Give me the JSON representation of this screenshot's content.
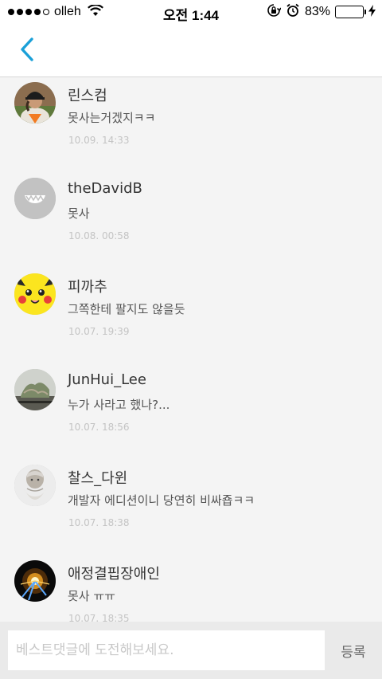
{
  "status_bar": {
    "carrier": "olleh",
    "time": "오전 1:44",
    "battery_percent": "83%",
    "battery_level": 0.83,
    "signal_bars": 4,
    "icons": [
      "signal-dots-icon",
      "wifi-icon",
      "orientation-lock-icon",
      "alarm-icon",
      "battery-icon",
      "charging-bolt-icon"
    ]
  },
  "nav": {
    "back_icon": "chevron-left-icon",
    "accent_color": "#1aa0d8"
  },
  "comments": [
    {
      "username": "린스컴",
      "text": "못사는거겠지ㅋㅋ",
      "date": "10.09. 14:33",
      "avatar": "baseball-player"
    },
    {
      "username": "theDavidB",
      "text": "못사",
      "date": "10.08. 00:58",
      "avatar": "default-gray"
    },
    {
      "username": "피까추",
      "text": "그쪽한테 팔지도 않을듯",
      "date": "10.07. 19:39",
      "avatar": "pikachu"
    },
    {
      "username": "JunHui_Lee",
      "text": "누가 사라고 했나?...",
      "date": "10.07. 18:56",
      "avatar": "landscape"
    },
    {
      "username": "찰스_다윈",
      "text": "개발자 에디션이니 당연히 비싸죱ㅋㅋ",
      "date": "10.07. 18:38",
      "avatar": "darwin-portrait"
    },
    {
      "username": "애정결핍장애인",
      "text": "못사 ㅠㅠ",
      "date": "10.07. 18:35",
      "avatar": "sparkler"
    }
  ],
  "input": {
    "placeholder": "베스트댓글에 도전해보세요.",
    "value": "",
    "submit_label": "등록"
  }
}
